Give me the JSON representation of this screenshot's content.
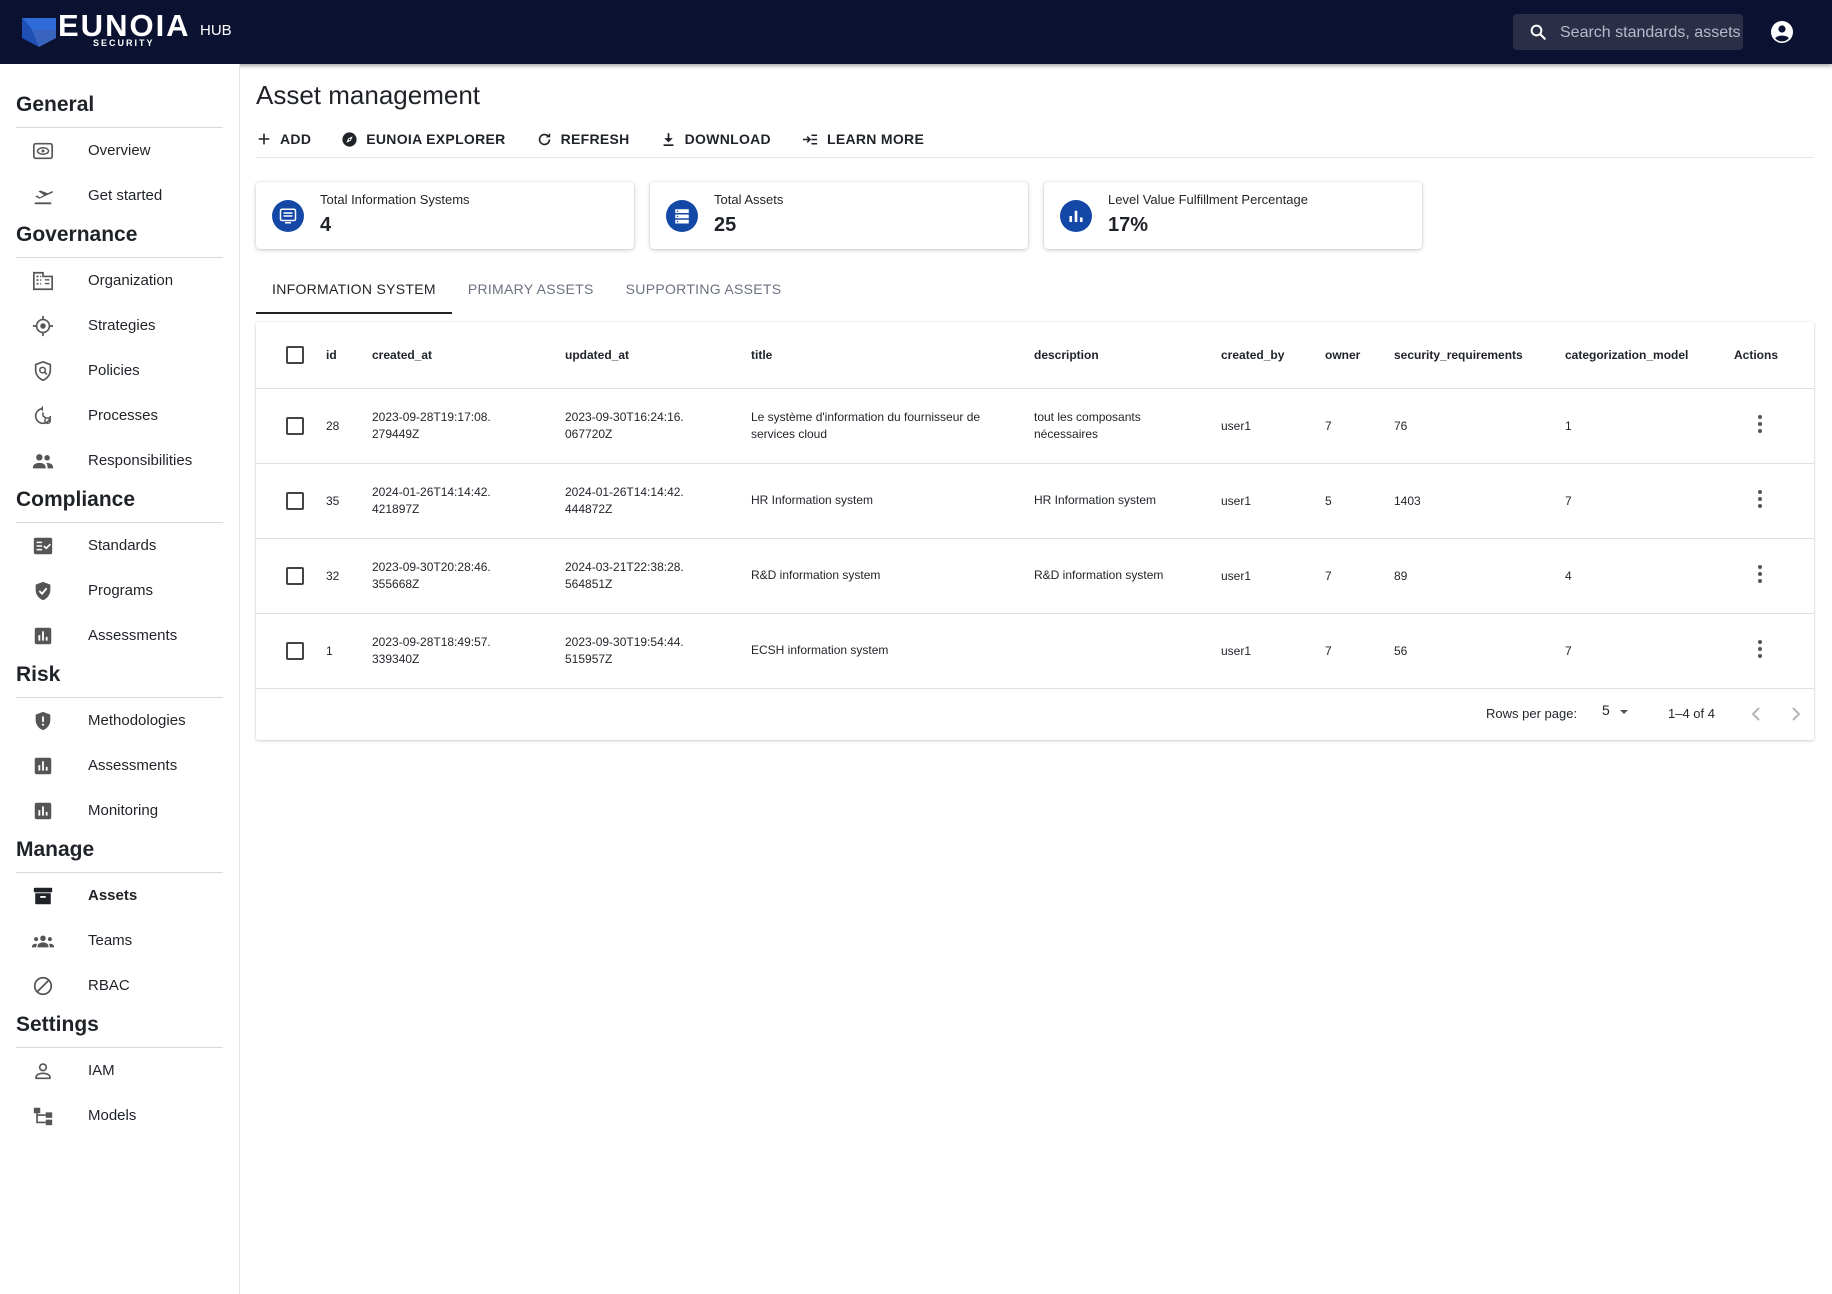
{
  "header": {
    "brand": "EUNOIA",
    "brand_sub": "SECURITY",
    "hub": "HUB",
    "search_placeholder": "Search standards, assets",
    "brand_color": "#0b1130"
  },
  "sidebar": {
    "sections": [
      {
        "heading": "General",
        "items": [
          {
            "label": "Overview",
            "icon": "eye-icon"
          },
          {
            "label": "Get started",
            "icon": "plane-takeoff-icon"
          }
        ]
      },
      {
        "heading": "Governance",
        "items": [
          {
            "label": "Organization",
            "icon": "building-icon"
          },
          {
            "label": "Strategies",
            "icon": "target-icon"
          },
          {
            "label": "Policies",
            "icon": "shield-search-icon"
          },
          {
            "label": "Processes",
            "icon": "cycle-gear-icon"
          },
          {
            "label": "Responsibilities",
            "icon": "people-icon"
          }
        ]
      },
      {
        "heading": "Compliance",
        "items": [
          {
            "label": "Standards",
            "icon": "checklist-icon"
          },
          {
            "label": "Programs",
            "icon": "shield-check-icon"
          },
          {
            "label": "Assessments",
            "icon": "bar-chart-icon"
          }
        ]
      },
      {
        "heading": "Risk",
        "items": [
          {
            "label": "Methodologies",
            "icon": "shield-alert-icon"
          },
          {
            "label": "Assessments",
            "icon": "bar-chart-icon"
          },
          {
            "label": "Monitoring",
            "icon": "bar-chart-icon"
          }
        ]
      },
      {
        "heading": "Manage",
        "items": [
          {
            "label": "Assets",
            "icon": "archive-box-icon",
            "active": true
          },
          {
            "label": "Teams",
            "icon": "groups-icon"
          },
          {
            "label": "RBAC",
            "icon": "block-icon"
          }
        ]
      },
      {
        "heading": "Settings",
        "items": [
          {
            "label": "IAM",
            "icon": "person-icon"
          },
          {
            "label": "Models",
            "icon": "model-tree-icon"
          }
        ]
      }
    ]
  },
  "main": {
    "title": "Asset management",
    "toolbar": {
      "add": "ADD",
      "explorer": "EUNOIA EXPLORER",
      "refresh": "REFRESH",
      "download": "DOWNLOAD",
      "learn_more": "LEARN MORE"
    },
    "stats": [
      {
        "label": "Total Information Systems",
        "value": "4",
        "icon": "list-icon"
      },
      {
        "label": "Total Assets",
        "value": "25",
        "icon": "storage-icon"
      },
      {
        "label": "Level Value Fulfillment Percentage",
        "value": "17%",
        "icon": "bar-chart-icon"
      }
    ],
    "tabs": [
      "INFORMATION SYSTEM",
      "PRIMARY ASSETS",
      "SUPPORTING ASSETS"
    ],
    "accent_color": "#1448a6",
    "table": {
      "columns": [
        "id",
        "created_at",
        "updated_at",
        "title",
        "description",
        "created_by",
        "owner",
        "security_requirements",
        "categorization_model",
        "Actions"
      ],
      "rows": [
        {
          "id": "28",
          "created_at": "2023-09-28T19:17:08.279449Z",
          "updated_at": "2023-09-30T16:24:16.067720Z",
          "title": "Le système d'information du fournisseur de services cloud",
          "description": "tout les composants nécessaires",
          "created_by": "user1",
          "owner": "7",
          "security_requirements": "76",
          "categorization_model": "1"
        },
        {
          "id": "35",
          "created_at": "2024-01-26T14:14:42.421897Z",
          "updated_at": "2024-01-26T14:14:42.444872Z",
          "title": "HR Information system",
          "description": "HR Information system",
          "created_by": "user1",
          "owner": "5",
          "security_requirements": "1403",
          "categorization_model": "7"
        },
        {
          "id": "32",
          "created_at": "2023-09-30T20:28:46.355668Z",
          "updated_at": "2024-03-21T22:38:28.564851Z",
          "title": "R&D information system",
          "description": "R&D information system",
          "created_by": "user1",
          "owner": "7",
          "security_requirements": "89",
          "categorization_model": "4"
        },
        {
          "id": "1",
          "created_at": "2023-09-28T18:49:57.339340Z",
          "updated_at": "2023-09-30T19:54:44.515957Z",
          "title": "ECSH information system",
          "description": "",
          "created_by": "user1",
          "owner": "7",
          "security_requirements": "56",
          "categorization_model": "7"
        }
      ]
    },
    "pagination": {
      "rows_per_page_label": "Rows per page:",
      "rows_per_page": "5",
      "range": "1–4 of 4"
    }
  }
}
